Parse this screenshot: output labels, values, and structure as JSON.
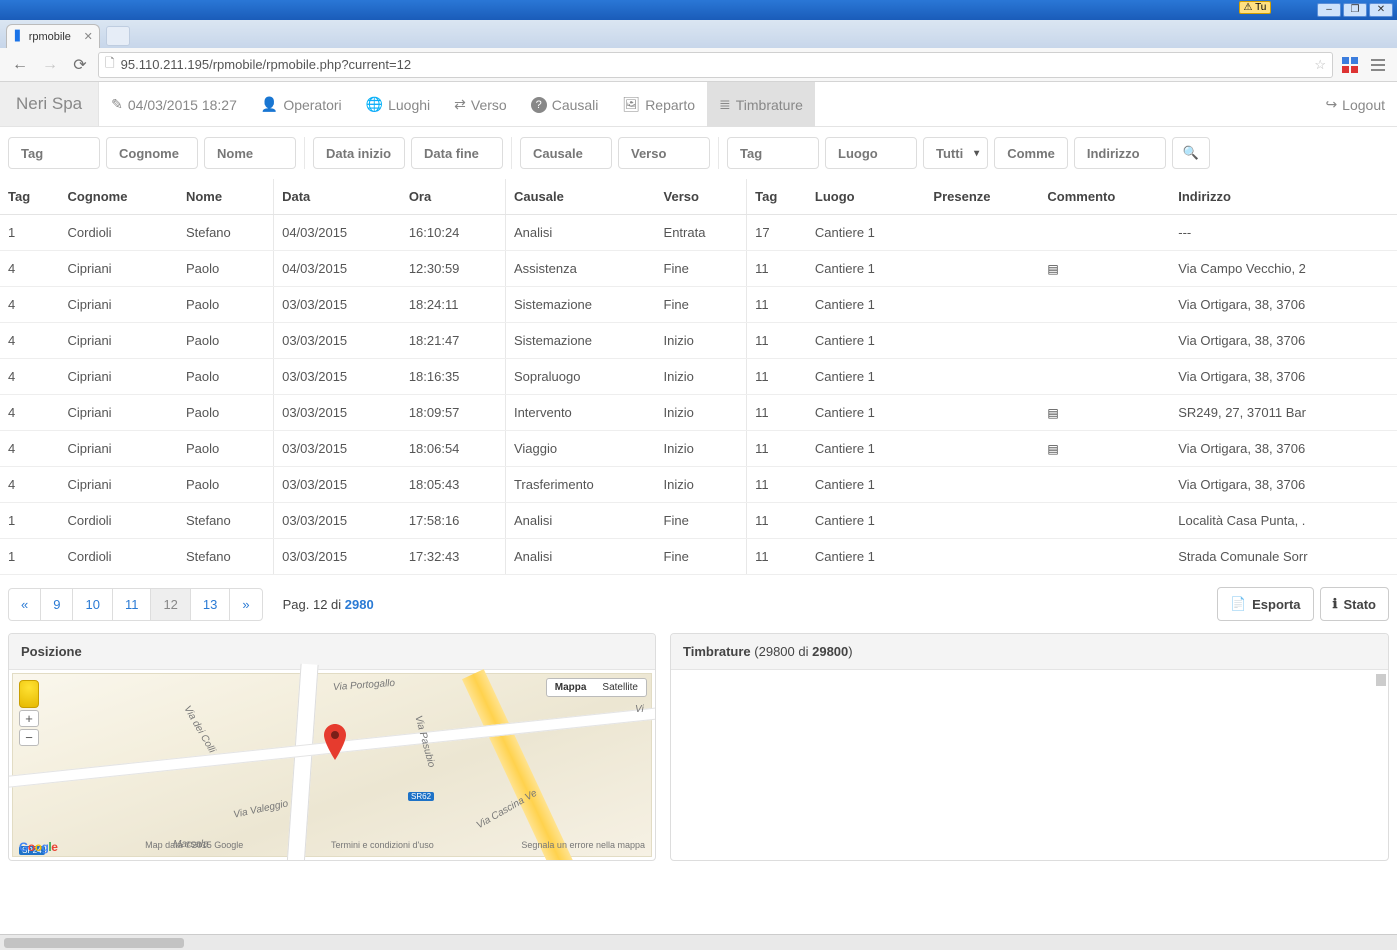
{
  "os": {
    "tu_label": "Tu",
    "min": "–",
    "max": "❐",
    "close": "✕"
  },
  "browser": {
    "tab_title": "rpmobile",
    "url": "95.110.211.195/rpmobile/rpmobile.php?current=12"
  },
  "navbar": {
    "brand": "Neri Spa",
    "timestamp": "04/03/2015 18:27",
    "items": [
      {
        "icon": "👤",
        "label": "Operatori"
      },
      {
        "icon": "🌐",
        "label": "Luoghi"
      },
      {
        "icon": "⇄",
        "label": "Verso"
      },
      {
        "icon": "?",
        "label": "Causali",
        "round": true
      },
      {
        "icon": "🖼",
        "label": "Reparto"
      },
      {
        "icon": "≣",
        "label": "Timbrature",
        "active": true
      }
    ],
    "logout": {
      "icon": "↪",
      "label": "Logout"
    }
  },
  "filters": {
    "tag1": "Tag",
    "cognome": "Cognome",
    "nome": "Nome",
    "data_inizio": "Data inizio",
    "data_fine": "Data fine",
    "causale": "Causale",
    "verso": "Verso",
    "tag2": "Tag",
    "luogo": "Luogo",
    "presenze": "Tutti",
    "commento": "Comme",
    "indirizzo": "Indirizzo"
  },
  "columns": {
    "tag": "Tag",
    "cognome": "Cognome",
    "nome": "Nome",
    "data": "Data",
    "ora": "Ora",
    "causale": "Causale",
    "verso": "Verso",
    "tag2": "Tag",
    "luogo": "Luogo",
    "presenze": "Presenze",
    "commento": "Commento",
    "indirizzo": "Indirizzo"
  },
  "rows": [
    {
      "tag": "1",
      "cognome": "Cordioli",
      "nome": "Stefano",
      "data": "04/03/2015",
      "ora": "16:10:24",
      "causale": "Analisi",
      "verso": "Entrata",
      "tag2": "17",
      "luogo": "Cantiere 1",
      "presenze": "",
      "commento": "",
      "indirizzo": "---"
    },
    {
      "tag": "4",
      "cognome": "Cipriani",
      "nome": "Paolo",
      "data": "04/03/2015",
      "ora": "12:30:59",
      "causale": "Assistenza",
      "verso": "Fine",
      "tag2": "11",
      "luogo": "Cantiere 1",
      "presenze": "",
      "commento": "note",
      "indirizzo": "Via Campo Vecchio, 2"
    },
    {
      "tag": "4",
      "cognome": "Cipriani",
      "nome": "Paolo",
      "data": "03/03/2015",
      "ora": "18:24:11",
      "causale": "Sistemazione",
      "verso": "Fine",
      "tag2": "11",
      "luogo": "Cantiere 1",
      "presenze": "",
      "commento": "",
      "indirizzo": "Via Ortigara, 38, 3706"
    },
    {
      "tag": "4",
      "cognome": "Cipriani",
      "nome": "Paolo",
      "data": "03/03/2015",
      "ora": "18:21:47",
      "causale": "Sistemazione",
      "verso": "Inizio",
      "tag2": "11",
      "luogo": "Cantiere 1",
      "presenze": "",
      "commento": "",
      "indirizzo": "Via Ortigara, 38, 3706"
    },
    {
      "tag": "4",
      "cognome": "Cipriani",
      "nome": "Paolo",
      "data": "03/03/2015",
      "ora": "18:16:35",
      "causale": "Sopraluogo",
      "verso": "Inizio",
      "tag2": "11",
      "luogo": "Cantiere 1",
      "presenze": "",
      "commento": "",
      "indirizzo": "Via Ortigara, 38, 3706"
    },
    {
      "tag": "4",
      "cognome": "Cipriani",
      "nome": "Paolo",
      "data": "03/03/2015",
      "ora": "18:09:57",
      "causale": "Intervento",
      "verso": "Inizio",
      "tag2": "11",
      "luogo": "Cantiere 1",
      "presenze": "",
      "commento": "note",
      "indirizzo": "SR249, 27, 37011 Bar"
    },
    {
      "tag": "4",
      "cognome": "Cipriani",
      "nome": "Paolo",
      "data": "03/03/2015",
      "ora": "18:06:54",
      "causale": "Viaggio",
      "verso": "Inizio",
      "tag2": "11",
      "luogo": "Cantiere 1",
      "presenze": "",
      "commento": "note",
      "indirizzo": "Via Ortigara, 38, 3706"
    },
    {
      "tag": "4",
      "cognome": "Cipriani",
      "nome": "Paolo",
      "data": "03/03/2015",
      "ora": "18:05:43",
      "causale": "Trasferimento",
      "verso": "Inizio",
      "tag2": "11",
      "luogo": "Cantiere 1",
      "presenze": "",
      "commento": "",
      "indirizzo": "Via Ortigara, 38, 3706"
    },
    {
      "tag": "1",
      "cognome": "Cordioli",
      "nome": "Stefano",
      "data": "03/03/2015",
      "ora": "17:58:16",
      "causale": "Analisi",
      "verso": "Fine",
      "tag2": "11",
      "luogo": "Cantiere 1",
      "presenze": "",
      "commento": "",
      "indirizzo": "Località Casa Punta, ."
    },
    {
      "tag": "1",
      "cognome": "Cordioli",
      "nome": "Stefano",
      "data": "03/03/2015",
      "ora": "17:32:43",
      "causale": "Analisi",
      "verso": "Fine",
      "tag2": "11",
      "luogo": "Cantiere 1",
      "presenze": "",
      "commento": "",
      "indirizzo": "Strada Comunale Sorr"
    }
  ],
  "pager": {
    "prev": "«",
    "pages": [
      "9",
      "10",
      "11",
      "12",
      "13"
    ],
    "active": "12",
    "next": "»",
    "info_prefix": "Pag. 12 di ",
    "info_total": "2980"
  },
  "actions": {
    "esporta": {
      "icon": "📄",
      "label": "Esporta"
    },
    "stato": {
      "icon": "ℹ",
      "label": "Stato"
    }
  },
  "panels": {
    "posizione": "Posizione",
    "timbrature_prefix": "Timbrature ",
    "timbrature_counts": "(29800 di ",
    "timbrature_total": "29800",
    "timbrature_suffix": ")"
  },
  "map": {
    "type_map": "Mappa",
    "type_sat": "Satellite",
    "labels": {
      "portogallo": "Via Portogallo",
      "pasubio": "Via Pasubio",
      "colli": "Via dei Colli",
      "valeggio": "Via Valeggio",
      "cascina": "Via Cascina Ve",
      "marsala": "Marsala",
      "vi": "Vi"
    },
    "shields": {
      "sr62": "SR62",
      "sp24": "SP24"
    },
    "foot_data": "Map data ©2015 Google",
    "foot_terms": "Termini e condizioni d'uso",
    "foot_report": "Segnala un errore nella mappa"
  }
}
